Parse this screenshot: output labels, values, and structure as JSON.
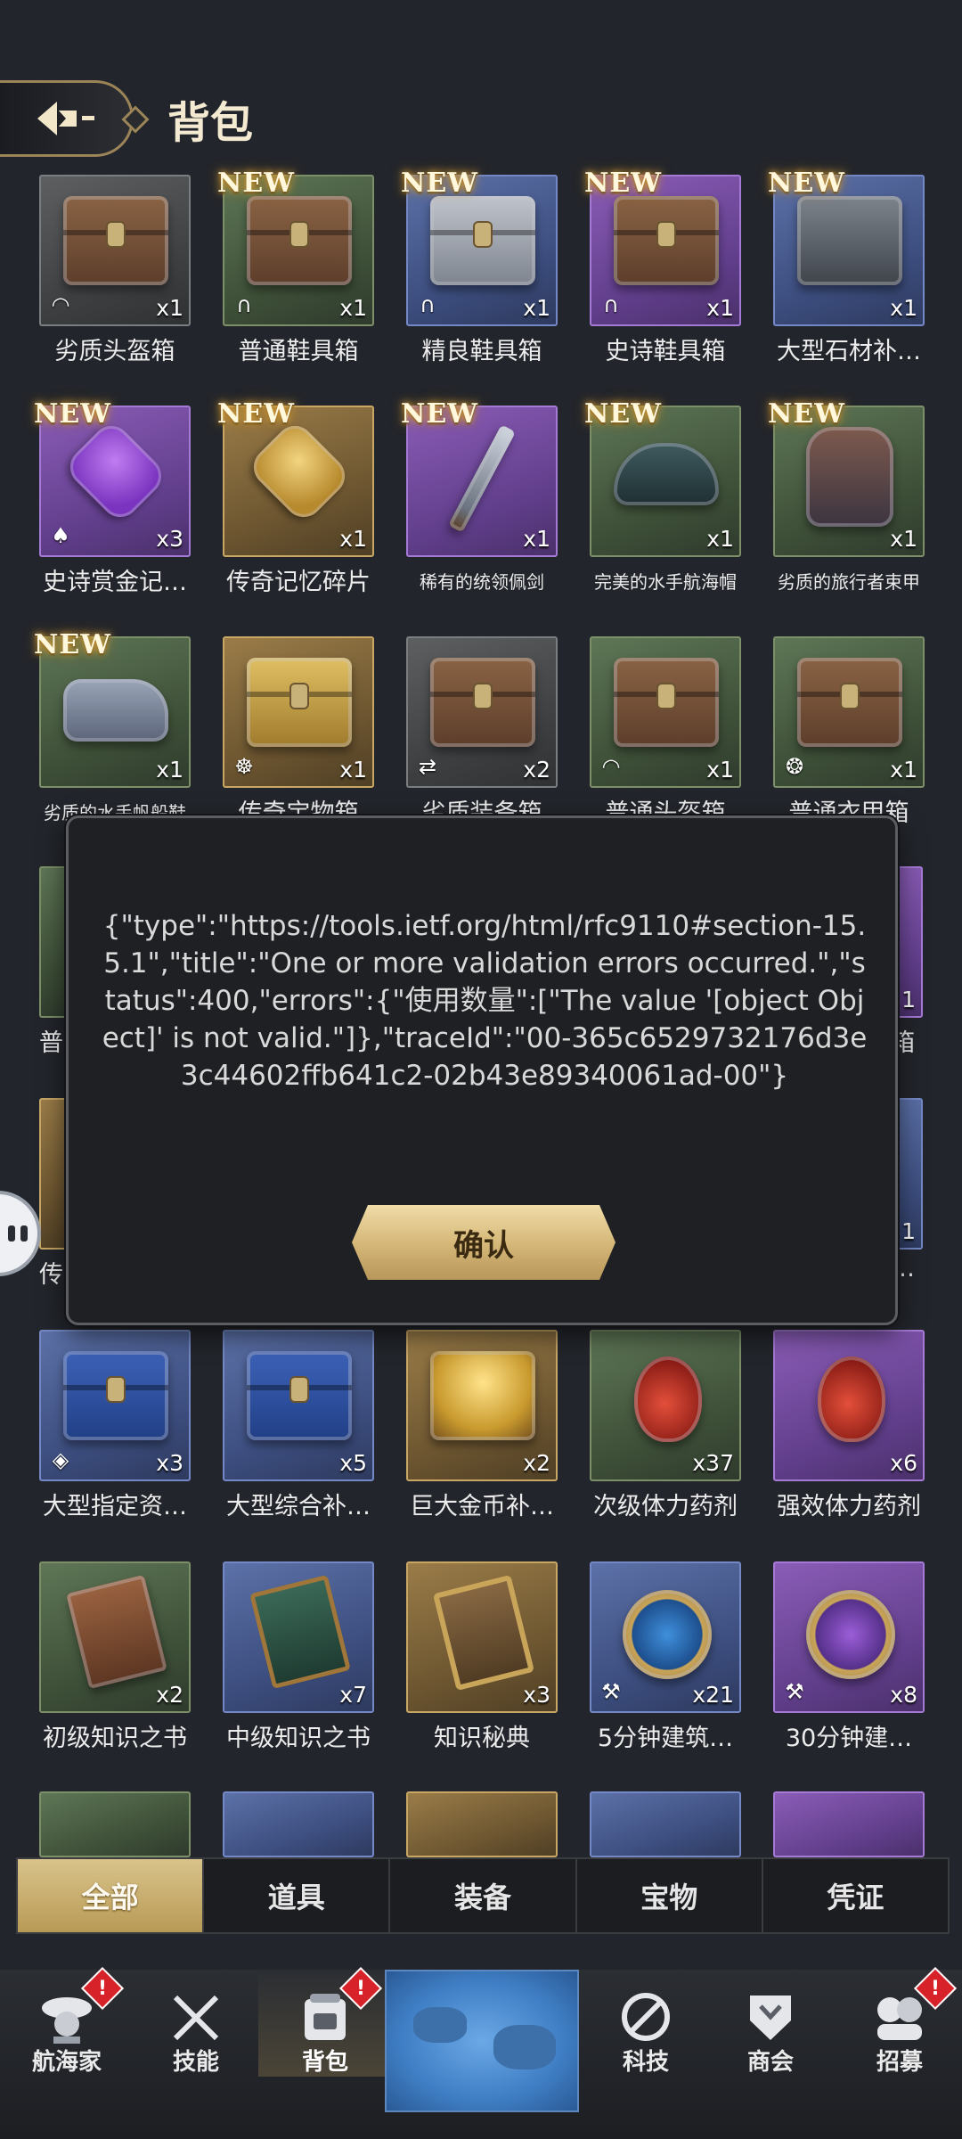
{
  "header": {
    "title": "背包",
    "back_icon": "back-arrow-icon"
  },
  "items": [
    {
      "name": "劣质头盔箱",
      "qty": "x1",
      "new": false,
      "rarity": "gray",
      "art": "chest",
      "type_icon": "helmet-icon"
    },
    {
      "name": "普通鞋具箱",
      "qty": "x1",
      "new": true,
      "rarity": "green",
      "art": "chest",
      "type_icon": "boots-icon"
    },
    {
      "name": "精良鞋具箱",
      "qty": "x1",
      "new": true,
      "rarity": "blue",
      "art": "chest-silver",
      "type_icon": "boots-icon"
    },
    {
      "name": "史诗鞋具箱",
      "qty": "x1",
      "new": true,
      "rarity": "purple",
      "art": "chest",
      "type_icon": "boots-icon"
    },
    {
      "name": "大型石材补…",
      "qty": "x1",
      "new": true,
      "rarity": "blue",
      "art": "stone",
      "type_icon": ""
    },
    {
      "name": "史诗赏金记…",
      "qty": "x3",
      "new": true,
      "rarity": "purple",
      "art": "puzzle-purple",
      "type_icon": "bounty-icon"
    },
    {
      "name": "传奇记忆碎片",
      "qty": "x1",
      "new": true,
      "rarity": "gold",
      "art": "puzzle-gold",
      "type_icon": ""
    },
    {
      "name": "稀有的统领佩剑",
      "qty": "x1",
      "new": true,
      "rarity": "purple",
      "art": "sword",
      "type_icon": ""
    },
    {
      "name": "完美的水手航海帽",
      "qty": "x1",
      "new": true,
      "rarity": "green",
      "art": "hat",
      "type_icon": ""
    },
    {
      "name": "劣质的旅行者束甲",
      "qty": "x1",
      "new": true,
      "rarity": "green",
      "art": "armor",
      "type_icon": ""
    },
    {
      "name": "劣质的水手帆船鞋",
      "qty": "x1",
      "new": true,
      "rarity": "green",
      "art": "boots",
      "type_icon": ""
    },
    {
      "name": "传奇宝物箱",
      "qty": "x1",
      "new": false,
      "rarity": "gold",
      "art": "chest-gold",
      "type_icon": "wheel-icon"
    },
    {
      "name": "劣质装备箱",
      "qty": "x2",
      "new": false,
      "rarity": "gray",
      "art": "chest",
      "type_icon": "shuffle-icon"
    },
    {
      "name": "普通头盔箱",
      "qty": "x1",
      "new": false,
      "rarity": "green",
      "art": "chest",
      "type_icon": "helmet-icon"
    },
    {
      "name": "普通衣甲箱",
      "qty": "x1",
      "new": false,
      "rarity": "green",
      "art": "chest",
      "type_icon": "armor-icon"
    },
    {
      "name": "大型指定资…",
      "qty": "x3",
      "new": false,
      "rarity": "blue",
      "art": "chest-blue",
      "type_icon": "shield-icon"
    },
    {
      "name": "大型综合补…",
      "qty": "x5",
      "new": false,
      "rarity": "blue",
      "art": "chest-blue",
      "type_icon": ""
    },
    {
      "name": "巨大金币补…",
      "qty": "x2",
      "new": false,
      "rarity": "gold",
      "art": "coins",
      "type_icon": ""
    },
    {
      "name": "次级体力药剂",
      "qty": "x37",
      "new": false,
      "rarity": "green",
      "art": "potion",
      "type_icon": ""
    },
    {
      "name": "强效体力药剂",
      "qty": "x6",
      "new": false,
      "rarity": "purple",
      "art": "potion",
      "type_icon": ""
    },
    {
      "name": "初级知识之书",
      "qty": "x2",
      "new": false,
      "rarity": "green",
      "art": "book-brown",
      "type_icon": ""
    },
    {
      "name": "中级知识之书",
      "qty": "x7",
      "new": false,
      "rarity": "blue",
      "art": "book-green",
      "type_icon": ""
    },
    {
      "name": "知识秘典",
      "qty": "x3",
      "new": false,
      "rarity": "gold",
      "art": "book-tome",
      "type_icon": ""
    },
    {
      "name": "5分钟建筑…",
      "qty": "x21",
      "new": false,
      "rarity": "blue",
      "art": "clock-blue",
      "type_icon": "hammer-icon"
    },
    {
      "name": "30分钟建…",
      "qty": "x8",
      "new": false,
      "rarity": "purple",
      "art": "clock-purple",
      "type_icon": "hammer-icon"
    }
  ],
  "hidden_row_labels": {
    "left_row4": "普",
    "right_row4": "箱",
    "qty_row4": "1",
    "left_row5": "传",
    "right_row5": "…",
    "qty_row5": "1"
  },
  "new_label": "NEW",
  "dialog": {
    "message": "{\"type\":\"https://tools.ietf.org/html/rfc9110#section-15.5.1\",\"title\":\"One or more validation errors occurred.\",\"status\":400,\"errors\":{\"使用数量\":[\"The value '[object Object]' is not valid.\"]},\"traceId\":\"00-365c6529732176d3e3c44602ffb641c2-02b43e89340061ad-00\"}",
    "confirm_label": "确认"
  },
  "tabs": [
    {
      "label": "全部",
      "active": true
    },
    {
      "label": "道具",
      "active": false
    },
    {
      "label": "装备",
      "active": false
    },
    {
      "label": "宝物",
      "active": false
    },
    {
      "label": "凭证",
      "active": false
    }
  ],
  "nav": [
    {
      "label": "航海家",
      "icon": "navigator-icon",
      "alert": true
    },
    {
      "label": "技能",
      "icon": "crossed-swords-icon",
      "alert": false
    },
    {
      "label": "背包",
      "icon": "backpack-icon",
      "alert": true,
      "active": true
    },
    {
      "label": "",
      "icon": "world-map-icon",
      "alert": false
    },
    {
      "label": "科技",
      "icon": "tech-compass-icon",
      "alert": false
    },
    {
      "label": "商会",
      "icon": "guild-crest-icon",
      "alert": false
    },
    {
      "label": "招募",
      "icon": "recruit-icon",
      "alert": true
    }
  ],
  "alert_mark": "!"
}
